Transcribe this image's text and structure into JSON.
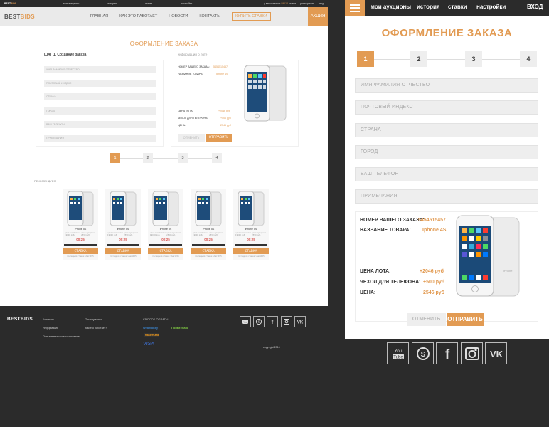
{
  "desktop": {
    "topbar": {
      "logo_a": "BEST",
      "logo_b": "BIDS",
      "nav": [
        "мои аукционы",
        "история",
        "ставки",
        "настройки"
      ],
      "balance_prefix": "у вас осталось",
      "balance_value": "BID12",
      "balance_suffix": "ставки",
      "register": "регистрация",
      "login": "вход"
    },
    "nav": {
      "brand_a": "BEST",
      "brand_b": "BIDS",
      "items": [
        "ГЛАВНАЯ",
        "КАК ЭТО РАБОТАЕТ",
        "НОВОСТИ",
        "КОНТАКТЫ"
      ],
      "buy": "КУПИТЬ СТАВКИ",
      "action": "АКЦИЯ"
    },
    "title": "ОФОРМЛЕНИЕ ЗАКАЗА",
    "step_label": "ШАГ 1. Создание заказа",
    "lot_label": "информация о лоте",
    "fields": [
      "ИМЯ ФАМИЛИЯ ОТЧЕСТВО",
      "ПОЧТОВЫЙ ИНДЕКС",
      "СТРАНА",
      "ГОРОД",
      "ВАШ ТЕЛЕФОН",
      "ПРИМЕЧАНИЯ"
    ],
    "order": {
      "order_no_label": "НОМЕР ВАШЕГО ЗАКАЗА:",
      "order_no": "5454515457",
      "product_label": "НАЗВАНИЕ ТОВАРА:",
      "product": "Iphone 4S",
      "lot_price_label": "ЦЕНА ЛОТА:",
      "lot_price": "+2046 руб",
      "case_label": "ЧЕХОЛ ДЛЯ ТЕЛЕФОНА:",
      "case_price": "+500 руб",
      "total_label": "ЦЕНА:",
      "total": "2546 руб",
      "cancel": "ОТМЕНИТЬ",
      "send": "ОТПРАВИТЬ"
    },
    "steps": [
      "1",
      "2",
      "3",
      "4"
    ],
    "rec_label": "РЕКОМЕНДУЕМ",
    "cards": [
      {
        "name": "iPhone 5S",
        "price": "00:25",
        "bid": "СТАВКА",
        "footer": "последняя ставка: User1455"
      },
      {
        "name": "iPhone 5S",
        "price": "00:25",
        "bid": "СТАВКА",
        "footer": "последняя ставка: User1455"
      },
      {
        "name": "iPhone 5S",
        "price": "00:25",
        "bid": "СТАВКА",
        "footer": "последняя ставка: User1455"
      },
      {
        "name": "iPhone 5S",
        "price": "00:25",
        "bid": "СТАВКА",
        "footer": "последняя ставка: User1455"
      },
      {
        "name": "iPhone 5S",
        "price": "00:25",
        "bid": "СТАВКА",
        "footer": "последняя ставка: User1455"
      }
    ],
    "card_meta_left": "цена в магазине 19000 руб.",
    "card_meta_right": "цена аукциона 2550 руб.",
    "footer": {
      "brand": "BESTBIDS",
      "col1": [
        "Контакты",
        "Информация",
        "Пользовательское соглашение"
      ],
      "col2": [
        "Техподдержка",
        "Как это работает?"
      ],
      "pay_title": "СПОСОБ ОПЛАТЫ",
      "pay": [
        "WebMoney",
        "ПриватБанк",
        "MasterCard",
        "VISA"
      ],
      "copyright": "copyright 2016"
    }
  },
  "mobile": {
    "nav": [
      "мои аукционы",
      "история",
      "ставки",
      "настройки",
      "ВХОД"
    ],
    "title": "ОФОРМЛЕНИЕ ЗАКАЗА",
    "steps": [
      "1",
      "2",
      "3",
      "4"
    ],
    "fields": [
      "ИМЯ ФАМИЛИЯ ОТЧЕСТВО",
      "ПОЧТОВЫЙ ИНДЕКС",
      "СТРАНА",
      "ГОРОД",
      "ВАШ ТЕЛЕФОН",
      "ПРИМЕЧАНИЯ"
    ],
    "order": {
      "order_no_label": "НОМЕР ВАШЕГО ЗАКАЗА:",
      "order_no": "5454515457",
      "product_label": "НАЗВАНИЕ ТОВАРА:",
      "product": "Iphone 4S",
      "lot_price_label": "ЦЕНА ЛОТА:",
      "lot_price": "+2046 руб",
      "case_label": "ЧЕХОЛ ДЛЯ ТЕЛЕФОНА:",
      "case_price": "+500 руб",
      "total_label": "ЦЕНА:",
      "total": "2546 руб"
    },
    "cancel": "ОТМЕНИТЬ",
    "send": "ОТПРАВИТЬ"
  },
  "colors": {
    "accent": "#e29b53",
    "dark": "#2b2b2b",
    "field": "#eeeeee"
  },
  "social_icons": [
    "youtube-icon",
    "skype-icon",
    "facebook-icon",
    "instagram-icon",
    "vk-icon"
  ]
}
